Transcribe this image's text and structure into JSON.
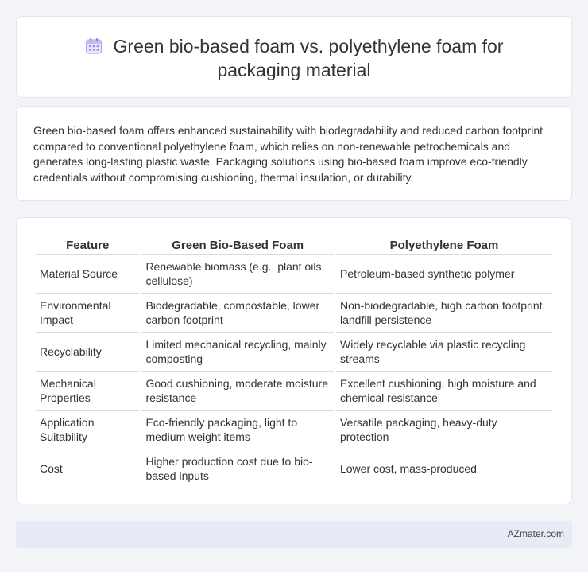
{
  "header": {
    "title": "Green bio-based foam vs. polyethylene foam for packaging material",
    "icon": "calendar-icon"
  },
  "intro": {
    "text": "Green bio-based foam offers enhanced sustainability with biodegradability and reduced carbon footprint compared to conventional polyethylene foam, which relies on non-renewable petrochemicals and generates long-lasting plastic waste. Packaging solutions using bio-based foam improve eco-friendly credentials without compromising cushioning, thermal insulation, or durability."
  },
  "table": {
    "headers": [
      "Feature",
      "Green Bio-Based Foam",
      "Polyethylene Foam"
    ],
    "rows": [
      [
        "Material Source",
        "Renewable biomass (e.g., plant oils, cellulose)",
        "Petroleum-based synthetic polymer"
      ],
      [
        "Environmental Impact",
        "Biodegradable, compostable, lower carbon footprint",
        "Non-biodegradable, high carbon footprint, landfill persistence"
      ],
      [
        "Recyclability",
        "Limited mechanical recycling, mainly composting",
        "Widely recyclable via plastic recycling streams"
      ],
      [
        "Mechanical Properties",
        "Good cushioning, moderate moisture resistance",
        "Excellent cushioning, high moisture and chemical resistance"
      ],
      [
        "Application Suitability",
        "Eco-friendly packaging, light to medium weight items",
        "Versatile packaging, heavy-duty protection"
      ],
      [
        "Cost",
        "Higher production cost due to bio-based inputs",
        "Lower cost, mass-produced"
      ]
    ]
  },
  "footer": {
    "brand": "AZmater.com"
  }
}
